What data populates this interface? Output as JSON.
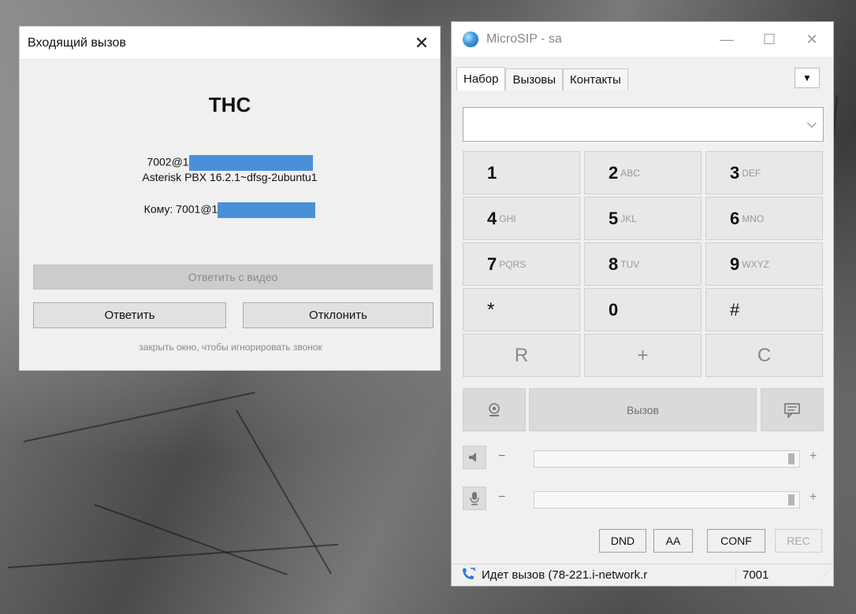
{
  "incoming": {
    "title": "Входящий вызов",
    "close_glyph": "✕",
    "caller_name": "THC",
    "caller_prefix": "7002@1",
    "caller_agent": "Asterisk PBX 16.2.1~dfsg-2ubuntu1",
    "to_prefix": "Кому: 7001@1",
    "answer_video": "Ответить с видео",
    "answer": "Ответить",
    "decline": "Отклонить",
    "hint": "закрыть окно, чтобы игнорировать звонок"
  },
  "microsip": {
    "title": "MicroSIP - sa",
    "minimize": "—",
    "maximize": "☐",
    "close": "✕",
    "tabs": [
      "Набор",
      "Вызовы",
      "Контакты"
    ],
    "tab_menu": "▼",
    "dial_value": "",
    "dropdown_glyph": "⌵",
    "keys": [
      {
        "digit": "1",
        "letters": ""
      },
      {
        "digit": "2",
        "letters": "ABC"
      },
      {
        "digit": "3",
        "letters": "DEF"
      },
      {
        "digit": "4",
        "letters": "GHI"
      },
      {
        "digit": "5",
        "letters": "JKL"
      },
      {
        "digit": "6",
        "letters": "MNO"
      },
      {
        "digit": "7",
        "letters": "PQRS"
      },
      {
        "digit": "8",
        "letters": "TUV"
      },
      {
        "digit": "9",
        "letters": "WXYZ"
      },
      {
        "digit": "*",
        "letters": ""
      },
      {
        "digit": "0",
        "letters": ""
      },
      {
        "digit": "#",
        "letters": ""
      },
      {
        "digit": "R",
        "letters": ""
      },
      {
        "digit": "+",
        "letters": ""
      },
      {
        "digit": "C",
        "letters": ""
      }
    ],
    "call_label": "Вызов",
    "speaker_level": 1.0,
    "mic_level": 1.0,
    "minus": "−",
    "plus": "+",
    "modes": [
      "DND",
      "AA",
      "CONF",
      "REC"
    ],
    "status_text": "Идет вызов (78-221.i-network.r",
    "status_number": "7001"
  },
  "colors": {
    "redaction": "#4a90d9",
    "app_icon": "#3b97e0"
  }
}
